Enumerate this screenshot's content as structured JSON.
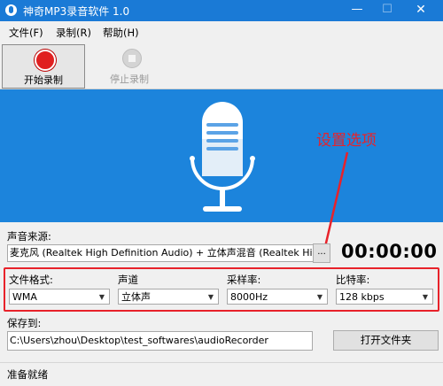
{
  "window": {
    "title": "神奇MP3录音软件 1.0",
    "minimize": "—",
    "maximize": "☐",
    "close": "✕"
  },
  "menu": [
    "文件(F)",
    "录制(R)",
    "帮助(H)"
  ],
  "toolbar": {
    "start_label": "开始录制",
    "stop_label": "停止录制"
  },
  "annotation": {
    "callout": "设置选项",
    "color": "#e8222a"
  },
  "source": {
    "label": "声音来源:",
    "value": "麦克风 (Realtek High Definition Audio) + 立体声混音 (Realtek High",
    "browse": "..."
  },
  "timer": "00:00:00",
  "settings": {
    "format": {
      "label": "文件格式:",
      "value": "WMA"
    },
    "channel": {
      "label": "声道",
      "value": "立体声"
    },
    "samplerate": {
      "label": "采样率:",
      "value": "8000Hz"
    },
    "bitrate": {
      "label": "比特率:",
      "value": "128 kbps"
    }
  },
  "save": {
    "label": "保存到:",
    "path": "C:\\Users\\zhou\\Desktop\\test_softwares\\audioRecorder",
    "open_button": "打开文件夹"
  },
  "status": "准备就绪",
  "colors": {
    "titlebar": "#1a7ad6",
    "panel": "#1c84dc",
    "accent_red": "#e8222a"
  }
}
